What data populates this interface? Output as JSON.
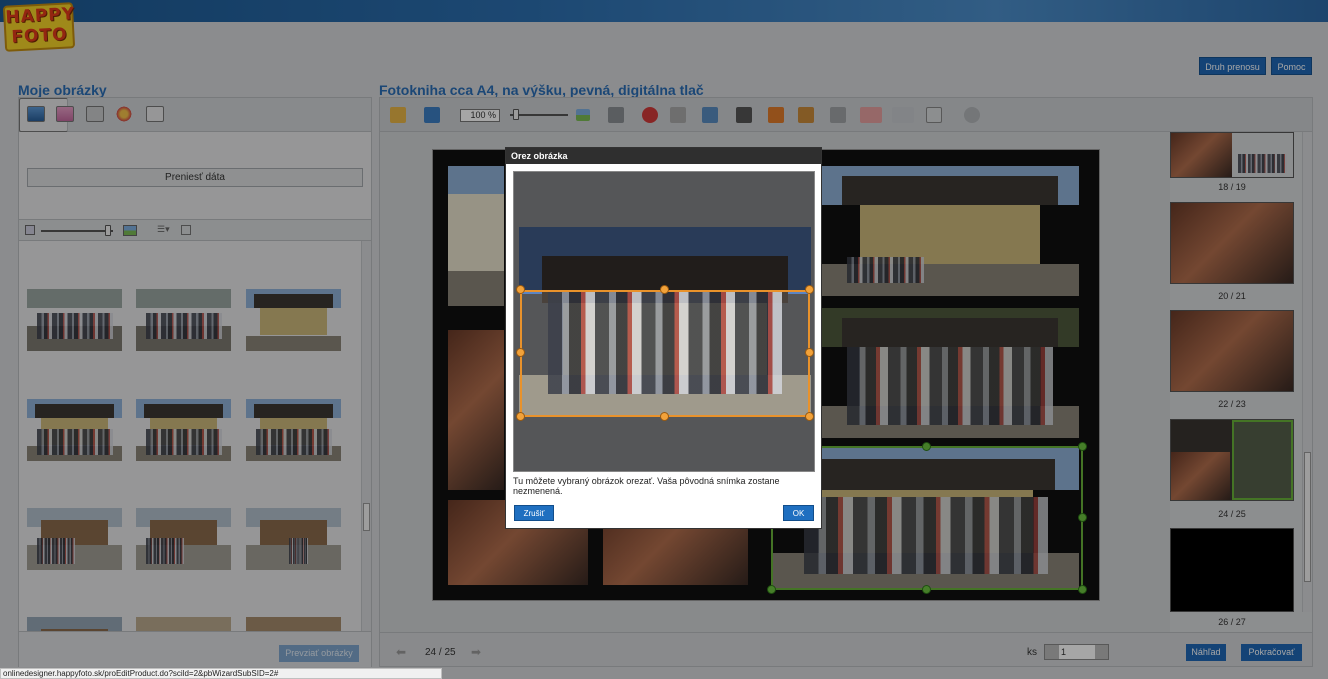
{
  "app": {
    "logo": [
      "HAPPY",
      "FOTO"
    ]
  },
  "header": {
    "transfer_type_label": "Druh prenosu",
    "help_label": "Pomoc"
  },
  "left_panel": {
    "title": "Moje obrázky",
    "transfer_button": "Preniesť dáta",
    "adopt_button": "Prevziať obrázky"
  },
  "editor": {
    "title": "Fotokniha cca A4, na výšku, pevná, digitálna tlač",
    "zoom": "100 %"
  },
  "page_strip": {
    "labels": [
      "18 / 19",
      "20 / 21",
      "22 / 23",
      "24 / 25",
      "26 / 27"
    ]
  },
  "footer": {
    "page_indicator": "24 / 25",
    "qty_label": "ks",
    "qty_value": "1",
    "preview_button": "Náhľad",
    "continue_button": "Pokračovať"
  },
  "modal": {
    "title": "Orez obrázka",
    "description": "Tu môžete vybraný obrázok orezať. Vaša pôvodná snímka zostane nezmenená.",
    "cancel_button": "Zrušiť",
    "ok_button": "OK"
  },
  "statusbar": {
    "url": "onlinedesigner.happyfoto.sk/proEditProduct.do?scild=2&pbWizardSubSID=2#"
  },
  "colors": {
    "accent": "#1f67b5",
    "title_blue": "#2a6db6",
    "crop_handle": "#e9922b",
    "selection_green": "#69b23a"
  }
}
